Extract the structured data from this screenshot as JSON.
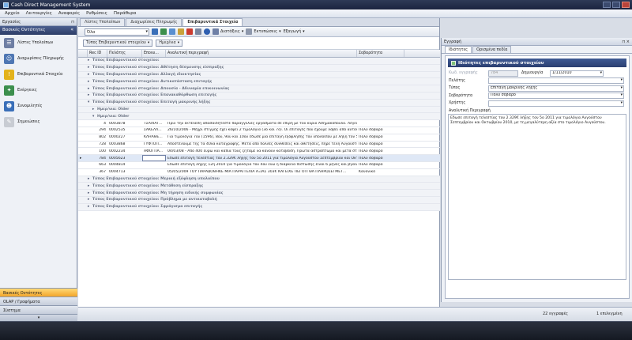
{
  "window": {
    "title": "Cash Direct Management System"
  },
  "menu": [
    "Αρχείο",
    "Λειτουργίες",
    "Αναφορές",
    "Ρυθμίσεις",
    "Παράθυρα"
  ],
  "sidebar": {
    "header": "Εργασίες",
    "pin": "⊓",
    "group_title": "Βασικές Οντότητες",
    "collapse": "«",
    "items": [
      {
        "label": "Λίστες Υπολοίπων",
        "icon": "list-icon",
        "color": "#6e7ea3",
        "glyph": "☰"
      },
      {
        "label": "Διαχωρίσεις Πληρωμής",
        "icon": "people-icon",
        "color": "#4f77b3",
        "glyph": "☺"
      },
      {
        "label": "Επιβαρυντικά Στοιχεία",
        "icon": "warning-icon",
        "color": "#e3b21b",
        "glyph": "!"
      },
      {
        "label": "Ενέργειες",
        "icon": "actions-icon",
        "color": "#3c8f4d",
        "glyph": "✦"
      },
      {
        "label": "Συνομιλητές",
        "icon": "contacts-icon",
        "color": "#3a6fb8",
        "glyph": "☻"
      },
      {
        "label": "Σημειώσεις",
        "icon": "notes-icon",
        "color": "#c8ccd3",
        "glyph": "✎"
      }
    ],
    "bottom": [
      {
        "label": "Βασικές Οντότητες",
        "active": true
      },
      {
        "label": "OLAP / Γραφήματα",
        "active": false
      },
      {
        "label": "Σύστημα",
        "active": false
      }
    ],
    "foot_glyph": "▾"
  },
  "doc_tabs": [
    {
      "label": "Λίστες Υπολοίπων",
      "active": false
    },
    {
      "label": "Διαχωρίσεις Πληρωμής",
      "active": false
    },
    {
      "label": "Επιβαρυντικά Στοιχεία",
      "active": true
    }
  ],
  "toolbar": {
    "filter_value": "Όλα",
    "settings_label": "Διατάξεις",
    "print_label": "Εκτυπώσεις",
    "export_label": "Εξαγωγή"
  },
  "filters": {
    "type_chip": "Τύπος Επιβαρυντικού στοιχείου",
    "date_chip": "Ημερ/νια"
  },
  "grid": {
    "columns": [
      "Rec ID",
      "Πελάτης",
      "Επονυ...",
      "Αναλυτική περιγραφή",
      "Σοβαρότητα"
    ],
    "rows": [
      {
        "kind": "group",
        "level": 1,
        "text": "Τύπος Επιβαρυντικού στοιχείου:",
        "toggle": "▸"
      },
      {
        "kind": "group",
        "level": 1,
        "text": "Τύπος Επιβαρυντικού στοιχείου: Αθέτηση δέσμευσης είσπραξης",
        "toggle": "▸"
      },
      {
        "kind": "group",
        "level": 1,
        "text": "Τύπος Επιβαρυντικού στοιχείου: Αλλαγή ιδιοκτησίας",
        "toggle": "▸"
      },
      {
        "kind": "group",
        "level": 1,
        "text": "Τύπος Επιβαρυντικού στοιχείου: Αντικατάσταση επιταγής",
        "toggle": "▸"
      },
      {
        "kind": "group",
        "level": 1,
        "text": "Τύπος Επιβαρυντικού στοιχείου: Απουσία - Αδυναμία επικοινωνίας",
        "toggle": "▸"
      },
      {
        "kind": "group",
        "level": 1,
        "text": "Τύπος Επιβαρυντικού στοιχείου: Επανακαθόρθωση επιταγής",
        "toggle": "▸"
      },
      {
        "kind": "group",
        "level": 1,
        "text": "Τύπος Επιβαρυντικού στοιχείου: Επιταγή μακρινής λήξης",
        "toggle": "▾"
      },
      {
        "kind": "group",
        "level": 2,
        "text": "Ημερ/νια: Older",
        "toggle": "▸"
      },
      {
        "kind": "group",
        "level": 2,
        "text": "Ημερ/νια: Older",
        "toggle": "▾"
      },
      {
        "kind": "data",
        "id": "4",
        "client": "0003878",
        "epon": "ΤΣΑΛΙΑΓ...",
        "desc": "Πριν την εκτέλεση απασαιδήτεστε παραγγελίες εργάσματα σε επιρή με τον κύριο Ασημακόπουλο. Λέγει τ...",
        "sev": ""
      },
      {
        "kind": "data",
        "id": "294",
        "client": "0002535",
        "epon": "ΣΑΚΕΛΛ...",
        "desc": "26/10/2006 - Μέχρι στιγμής έχει κόψει 2 τιμολόγια (3ο και 7ο). Οι επιταγές που έχουμε λάβει από αυτόν εί...",
        "sev": "Πολύ σοβαρό"
      },
      {
        "kind": "data",
        "id": "802",
        "client": "0000227",
        "epon": "ΚΛΗΑΘΕ...",
        "desc": "Για τιμολόγια 7ου (1596), 8ου, 9ου και 10ου έδωσε μία επιταγή εξόφλησης του υπολοίπου με λήξη τον 5ο ...",
        "sev": "Πολύ σοβαρό"
      },
      {
        "kind": "data",
        "id": "728",
        "client": "0003868",
        "epon": "ΓΥΦΤΟΠ...",
        "desc": "Αποστέλουμε της τα 40να καταγραφής. Μετά από πολλές συνθέσεις και αθετήσεις, πήρε τελη Αυγούστου...",
        "sev": "Πολύ σοβαρό"
      },
      {
        "kind": "data",
        "id": "100",
        "client": "0002234",
        "epon": "ΑΦΟΙ ΠΑ...",
        "desc": "04/03/08 - Από 400 ευρώ και κάπια τους ζητάμε να κάνουν καταβάση. Πρώτα αστράπτωμα και μετά σταλ...",
        "sev": "Πολύ σοβαρό"
      },
      {
        "kind": "data",
        "id": "784",
        "client": "0005623",
        "epon": "",
        "desc": "Εδωσε επιταγή τελεστίας του 2.329€ λήξης τον 5ο 2011 για τιμολόγια Αυγούστου Σεπτεμβρίου και Οκτωβ...",
        "sev": "Πολύ σοβαρό",
        "selected": true
      },
      {
        "kind": "data",
        "id": "663",
        "client": "0004814",
        "epon": "",
        "desc": "Εδωσε επιταγή λήξης 12η 2010 για τιμολόγια του 4ου ενώ η διάρκεια πίστωσης είναι 6 μήνες και βγαίνουμ...",
        "sev": "Πολύ σοβαρό"
      },
      {
        "kind": "data",
        "id": "367",
        "client": "0004713",
        "epon": "",
        "desc": "05/05/2009 ΤΟΥ ΠΑΡΑΔΟΘΗΚΕ ΜΙΑ ΠΑΡΑΓΓΕΛΙΑ ΑΞΙΑΣ 303€ ΚΑΙ ΕΙΧΕ ΠΕΙ ΟΤΙ ΘΑ ΠΛΗΡΩΣΕΙ ΜΕΤ...",
        "sev": "Κανονικό"
      },
      {
        "kind": "group",
        "level": 1,
        "text": "Τύπος Επιβαρυντικού στοιχείου: Μερική εξόφληση υπολοίπου",
        "toggle": "▸"
      },
      {
        "kind": "group",
        "level": 1,
        "text": "Τύπος Επιβαρυντικού στοιχείου: Μετάθεση είσπραξης",
        "toggle": "▸"
      },
      {
        "kind": "group",
        "level": 1,
        "text": "Τύπος Επιβαρυντικού στοιχείου: Μη τήρηση ειδικής συμφωνίας",
        "toggle": "▸"
      },
      {
        "kind": "group",
        "level": 1,
        "text": "Τύπος Επιβαρυντικού στοιχείου: Πρόβλημα με αντικαταβολή",
        "toggle": "▸"
      },
      {
        "kind": "group",
        "level": 1,
        "text": "Τύπος Επιβαρυντικού στοιχείου: Σφράγισμα επιταγής",
        "toggle": "▸"
      }
    ]
  },
  "details": {
    "header": "Εγγραφή",
    "pin": "⊓ ×",
    "tabs": [
      {
        "label": "Ιδιότητες",
        "active": true
      },
      {
        "label": "Ορισμένα πεδία",
        "active": false
      }
    ],
    "title": "Ιδιότητες επιβαρυντικού στοιχείου",
    "code_label": "Κωδ. εγγραφής",
    "code_value": "784",
    "created_label": "Δημιουργία",
    "created_value": "1/11/2010",
    "client_label": "Πελάτης",
    "client_value": "",
    "type_label": "Τύπος",
    "type_value": "Επιταγή μακρινής λήξης",
    "severity_label": "Σοβαρότητα",
    "severity_value": "Πολύ σοβαρό",
    "user_label": "Χρήστης",
    "user_value": "",
    "desc_label": "Αναλυτική Περιγραφή",
    "desc_value": "Εδωσε επιταγή τελεστίας του 2.329€ λήξης τον 5ο 2011 για τιμολόγια Αυγούστου Σεπτεμβρίου και Οκτωβρίου 2010, με τη μεγαλύτερη αξία στο τιμολόγιο Αυγούστου."
  },
  "status": {
    "records": "22 εγγραφές",
    "selected": "1 επιλεγμένη"
  }
}
